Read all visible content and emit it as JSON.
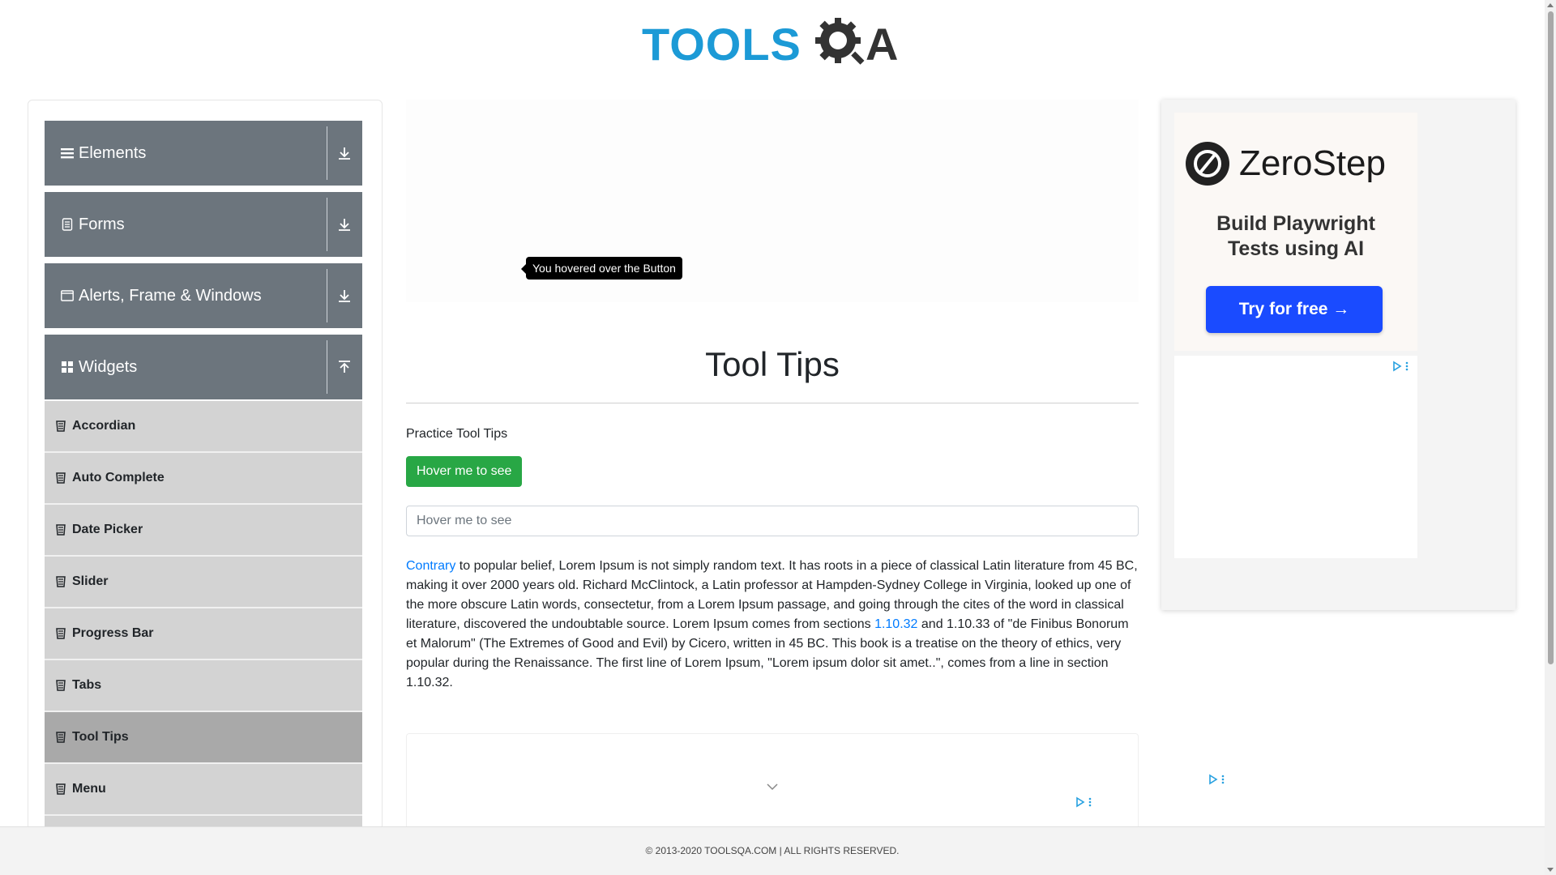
{
  "logo": {
    "part1": "TOOLS",
    "part2": "A"
  },
  "sidebar": {
    "groups": [
      {
        "label": "Elements",
        "icon": "hamburger-icon",
        "arrow": "download-icon"
      },
      {
        "label": "Forms",
        "icon": "document-icon",
        "arrow": "download-icon"
      },
      {
        "label": "Alerts, Frame & Windows",
        "icon": "window-icon",
        "arrow": "download-icon"
      },
      {
        "label": "Widgets",
        "icon": "grid-icon",
        "arrow": "upload-icon"
      }
    ],
    "items": [
      {
        "label": "Accordian"
      },
      {
        "label": "Auto Complete"
      },
      {
        "label": "Date Picker"
      },
      {
        "label": "Slider"
      },
      {
        "label": "Progress Bar"
      },
      {
        "label": "Tabs"
      },
      {
        "label": "Tool Tips",
        "active": true
      },
      {
        "label": "Menu"
      }
    ]
  },
  "main": {
    "tooltip": "You hovered over the Button",
    "title": "Tool Tips",
    "section_label": "Practice Tool Tips",
    "button_label": "Hover me to see",
    "input_placeholder": "Hover me to see",
    "paragraph": {
      "link1": "Contrary",
      "text1": " to popular belief, Lorem Ipsum is not simply random text. It has roots in a piece of classical Latin literature from 45 BC, making it over 2000 years old. Richard McClintock, a Latin professor at Hampden-Sydney College in Virginia, looked up one of the more obscure Latin words, consectetur, from a Lorem Ipsum passage, and going through the cites of the word in classical literature, discovered the undoubtable source. Lorem Ipsum comes from sections ",
      "link2": "1.10.32",
      "text2": " and 1.10.33 of \"de Finibus Bonorum et Malorum\" (The Extremes of Good and Evil) by Cicero, written in 45 BC. This book is a treatise on the theory of ethics, very popular during the Renaissance. The first line of Lorem Ipsum, \"Lorem ipsum dolor sit amet..\", comes from a line in section 1.10.32."
    }
  },
  "right_ad": {
    "brand": "ZeroStep",
    "tagline_line1": "Build Playwright",
    "tagline_line2": "Tests using AI",
    "cta": "Try for free →"
  },
  "footer": {
    "text": "© 2013-2020 TOOLSQA.COM | ALL RIGHTS RESERVED."
  },
  "colors": {
    "sidebar_header": "#6c757d",
    "menu_item": "#d3d3d3",
    "menu_item_active": "#a9a9a9",
    "button_green": "#28a745",
    "link_blue": "#007bff",
    "logo_blue": "#1c9ad6",
    "cta_blue": "#1a4bff"
  }
}
